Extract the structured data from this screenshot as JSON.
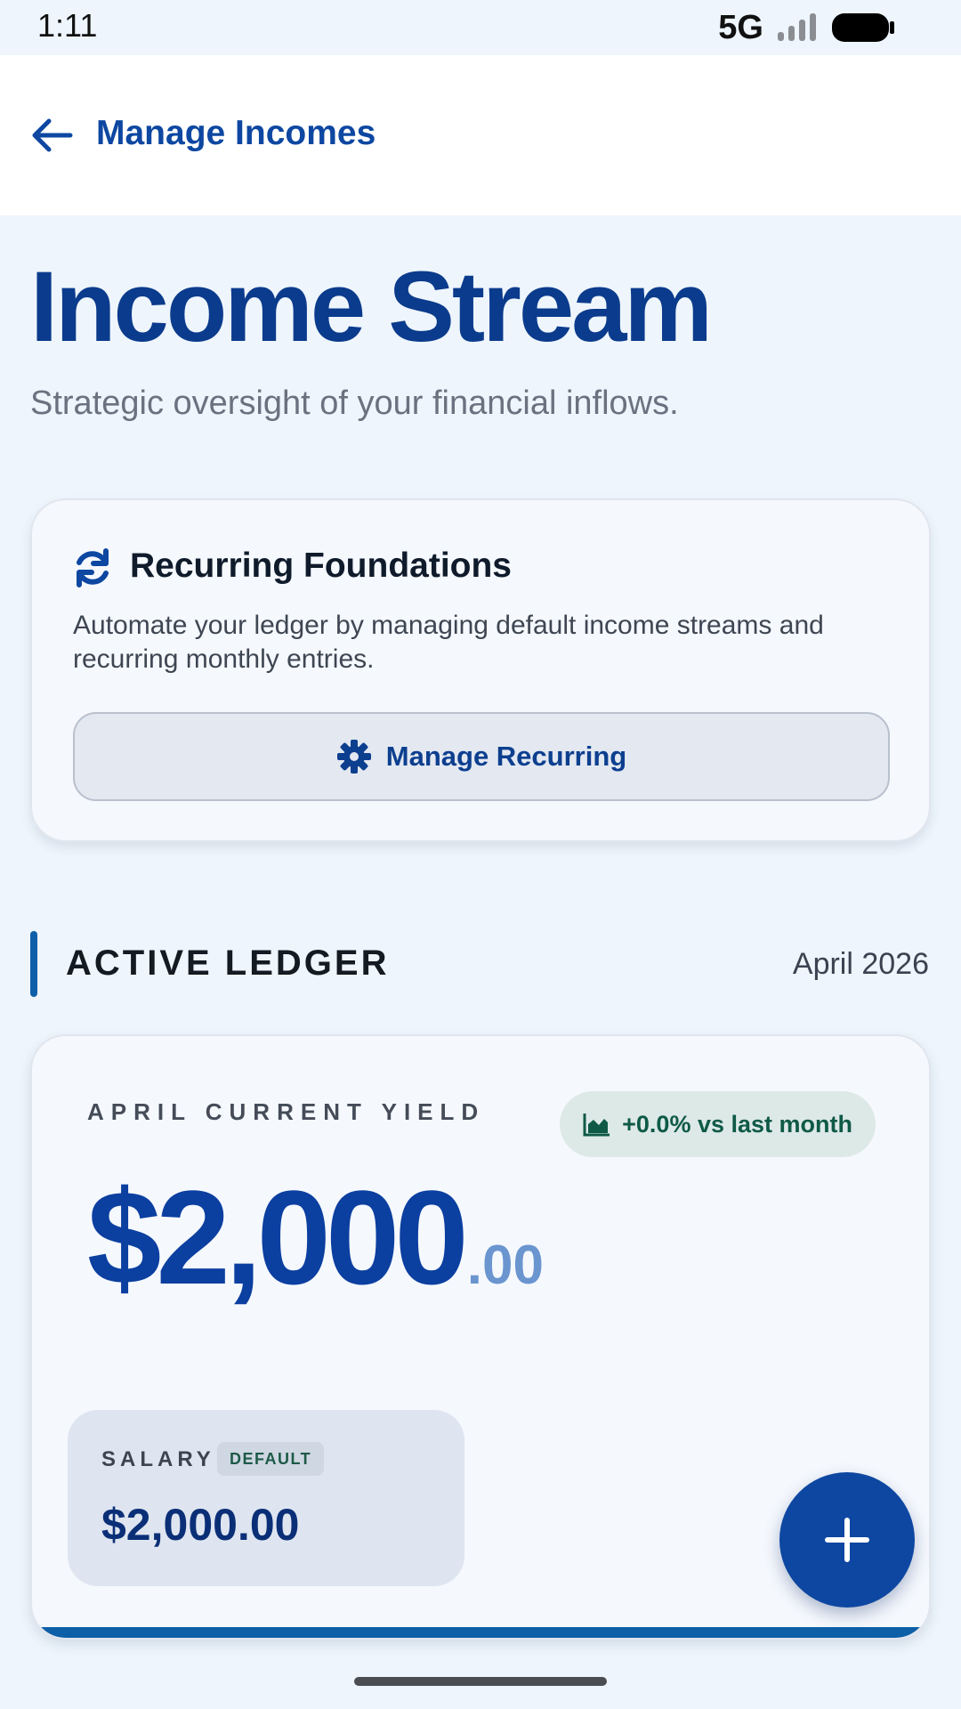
{
  "status_bar": {
    "time": "1:11",
    "network": "5G"
  },
  "app_bar": {
    "title": "Manage Incomes",
    "back_icon": "arrow-left-icon"
  },
  "hero": {
    "title": "Income Stream",
    "subtitle": "Strategic oversight of your financial inflows."
  },
  "recurring_card": {
    "icon": "refresh-icon",
    "title": "Recurring Foundations",
    "description": "Automate your ledger by managing default income streams and recurring monthly entries.",
    "button_label": "Manage Recurring",
    "button_icon": "gear-icon"
  },
  "ledger": {
    "heading": "ACTIVE LEDGER",
    "month": "April 2026"
  },
  "yield_card": {
    "label": "APRIL CURRENT YIELD",
    "amount_whole": "$2,000",
    "amount_cents": ".00",
    "trend": "+0.0% vs last month",
    "trend_icon": "area-chart-icon",
    "income_sources": [
      {
        "name": "SALARY",
        "badge": "DEFAULT",
        "amount": "$2,000.00"
      }
    ]
  },
  "fab": {
    "icon": "plus-icon"
  },
  "colors": {
    "primary": "#0d47a1",
    "background": "#eef5fc",
    "accent_green": "#0f5a47"
  }
}
